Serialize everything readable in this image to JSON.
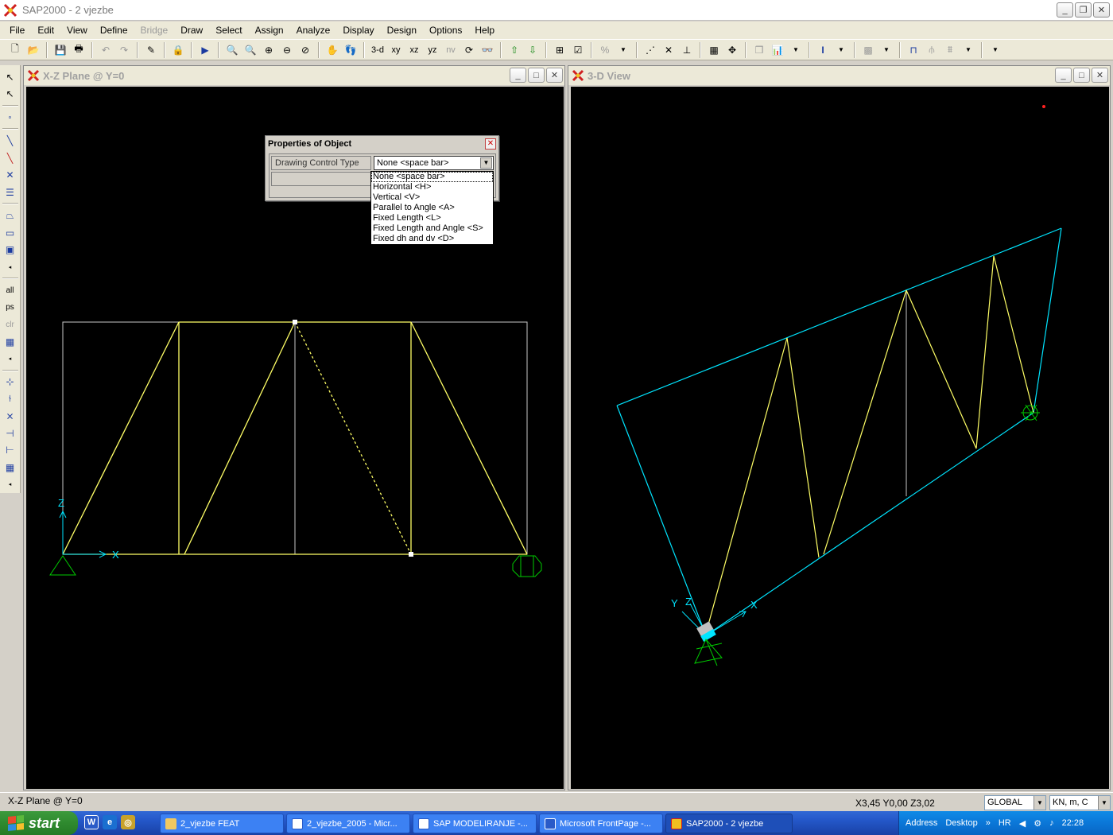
{
  "window": {
    "title": "SAP2000  - 2 vjezbe"
  },
  "menu": [
    "File",
    "Edit",
    "View",
    "Define",
    "Bridge",
    "Draw",
    "Select",
    "Assign",
    "Analyze",
    "Display",
    "Design",
    "Options",
    "Help"
  ],
  "toolbar": {
    "view_3d": "3-d",
    "view_xy": "xy",
    "view_xz": "xz",
    "view_yz": "yz",
    "view_nv": "nv"
  },
  "left_toolbar": {
    "all": "all",
    "ps": "ps",
    "clr": "clr"
  },
  "panels": {
    "left": {
      "title": "X-Z Plane @ Y=0"
    },
    "right": {
      "title": "3-D View"
    }
  },
  "axes": {
    "x": "X",
    "y": "Y",
    "z": "Z"
  },
  "dialog": {
    "title": "Properties of Object",
    "property_label": "Drawing Control Type",
    "selected_value": "None  <space bar>",
    "options": [
      "None  <space bar>",
      "Horizontal  <H>",
      "Vertical  <V>",
      "Parallel to Angle  <A>",
      "Fixed Length  <L>",
      "Fixed Length and Angle  <S>",
      "Fixed dh and dv  <D>"
    ]
  },
  "statusbar": {
    "view": "X-Z Plane @ Y=0",
    "coords": "X3,45  Y0,00  Z3,02",
    "coord_system": "GLOBAL",
    "units": "KN, m, C"
  },
  "taskbar": {
    "start": "start",
    "tasks": [
      "2_vjezbe FEAT",
      "2_vjezbe_2005 - Micr...",
      "SAP  MODELIRANJE -...",
      "Microsoft FrontPage -...",
      "SAP2000 - 2 vjezbe"
    ],
    "address": "Address",
    "desktop": "Desktop",
    "language": "HR",
    "time": "22:28"
  },
  "colors": {
    "member": "#ffff66",
    "frame_3d": "#00e5ff",
    "support": "#00cc00",
    "axis": "#00e5ff",
    "grid": "#c8c8c8"
  }
}
